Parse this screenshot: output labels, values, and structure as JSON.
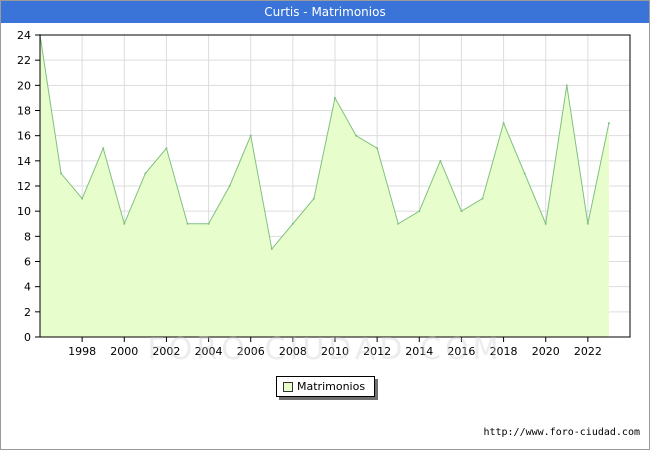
{
  "header": {
    "title": "Curtis - Matrimonios"
  },
  "watermark_text": "FORO-CIUDAD.COM",
  "footer": {
    "source_url": "http://www.foro-ciudad.com"
  },
  "colors": {
    "title_bar": "#3a74d8",
    "area_fill": "#e8fdcc",
    "line": "#80c080",
    "grid": "#dddddd"
  },
  "chart_data": {
    "type": "area",
    "title": "Curtis - Matrimonios",
    "xlabel": "",
    "ylabel": "",
    "x": [
      1996,
      1997,
      1998,
      1999,
      2000,
      2001,
      2002,
      2003,
      2004,
      2005,
      2006,
      2007,
      2008,
      2009,
      2010,
      2011,
      2012,
      2013,
      2014,
      2015,
      2016,
      2017,
      2018,
      2019,
      2020,
      2021,
      2022,
      2023
    ],
    "series": [
      {
        "name": "Matrimonios",
        "values": [
          24,
          13,
          11,
          15,
          9,
          13,
          15,
          9,
          9,
          12,
          16,
          7,
          9,
          11,
          19,
          16,
          15,
          9,
          10,
          14,
          10,
          11,
          17,
          13,
          9,
          20,
          9,
          17
        ]
      }
    ],
    "xticks": [
      1998,
      2000,
      2002,
      2004,
      2006,
      2008,
      2010,
      2012,
      2014,
      2016,
      2018,
      2020,
      2022
    ],
    "yticks": [
      0,
      2,
      4,
      6,
      8,
      10,
      12,
      14,
      16,
      18,
      20,
      22,
      24
    ],
    "xlim": [
      1996,
      2024
    ],
    "ylim": [
      0,
      24
    ],
    "grid": true,
    "legend": {
      "position": "bottom-center",
      "entries": [
        "Matrimonios"
      ]
    }
  }
}
